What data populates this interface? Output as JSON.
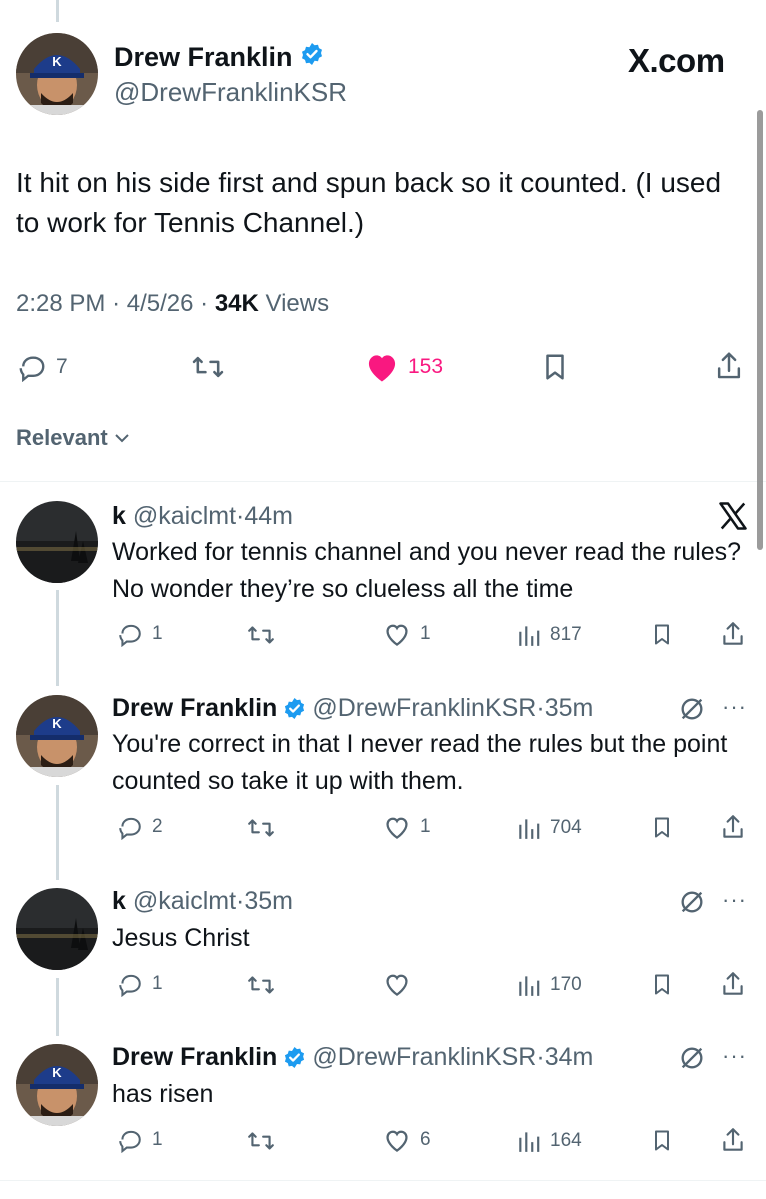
{
  "main_tweet": {
    "author_name": "Drew Franklin",
    "handle": "@DrewFranklinKSR",
    "site_label": "X.com",
    "text": "It hit on his side first and spun back so it counted.  (I used to work for Tennis Channel.)",
    "time": "2:28 PM",
    "date": "4/5/26",
    "views_count": "34K",
    "views_label": "Views",
    "replies": "7",
    "likes": "153",
    "liked_color": "#f91880"
  },
  "sort": {
    "label": "Relevant"
  },
  "replies": [
    {
      "name": "k",
      "handle": "@kaiclmt",
      "time": "44m",
      "text": "Worked for tennis channel and you never read the rules? No wonder they’re so clueless all the time",
      "replies": "1",
      "likes": "1",
      "views": "817"
    },
    {
      "name": "Drew Franklin",
      "handle": "@DrewFranklinKSR",
      "time": "35m",
      "text": "You're correct in that I never read the rules but the point counted so take it up with them.",
      "replies": "2",
      "likes": "1",
      "views": "704"
    },
    {
      "name": "k",
      "handle": "@kaiclmt",
      "time": "35m",
      "text": "Jesus Christ",
      "replies": "1",
      "likes": "",
      "views": "170"
    },
    {
      "name": "Drew Franklin",
      "handle": "@DrewFranklinKSR",
      "time": "34m",
      "text": "has risen",
      "replies": "1",
      "likes": "6",
      "views": "164"
    }
  ],
  "colors": {
    "verified_blue": "#1d9bf0",
    "muted": "#536471",
    "line": "#cfd9de"
  }
}
